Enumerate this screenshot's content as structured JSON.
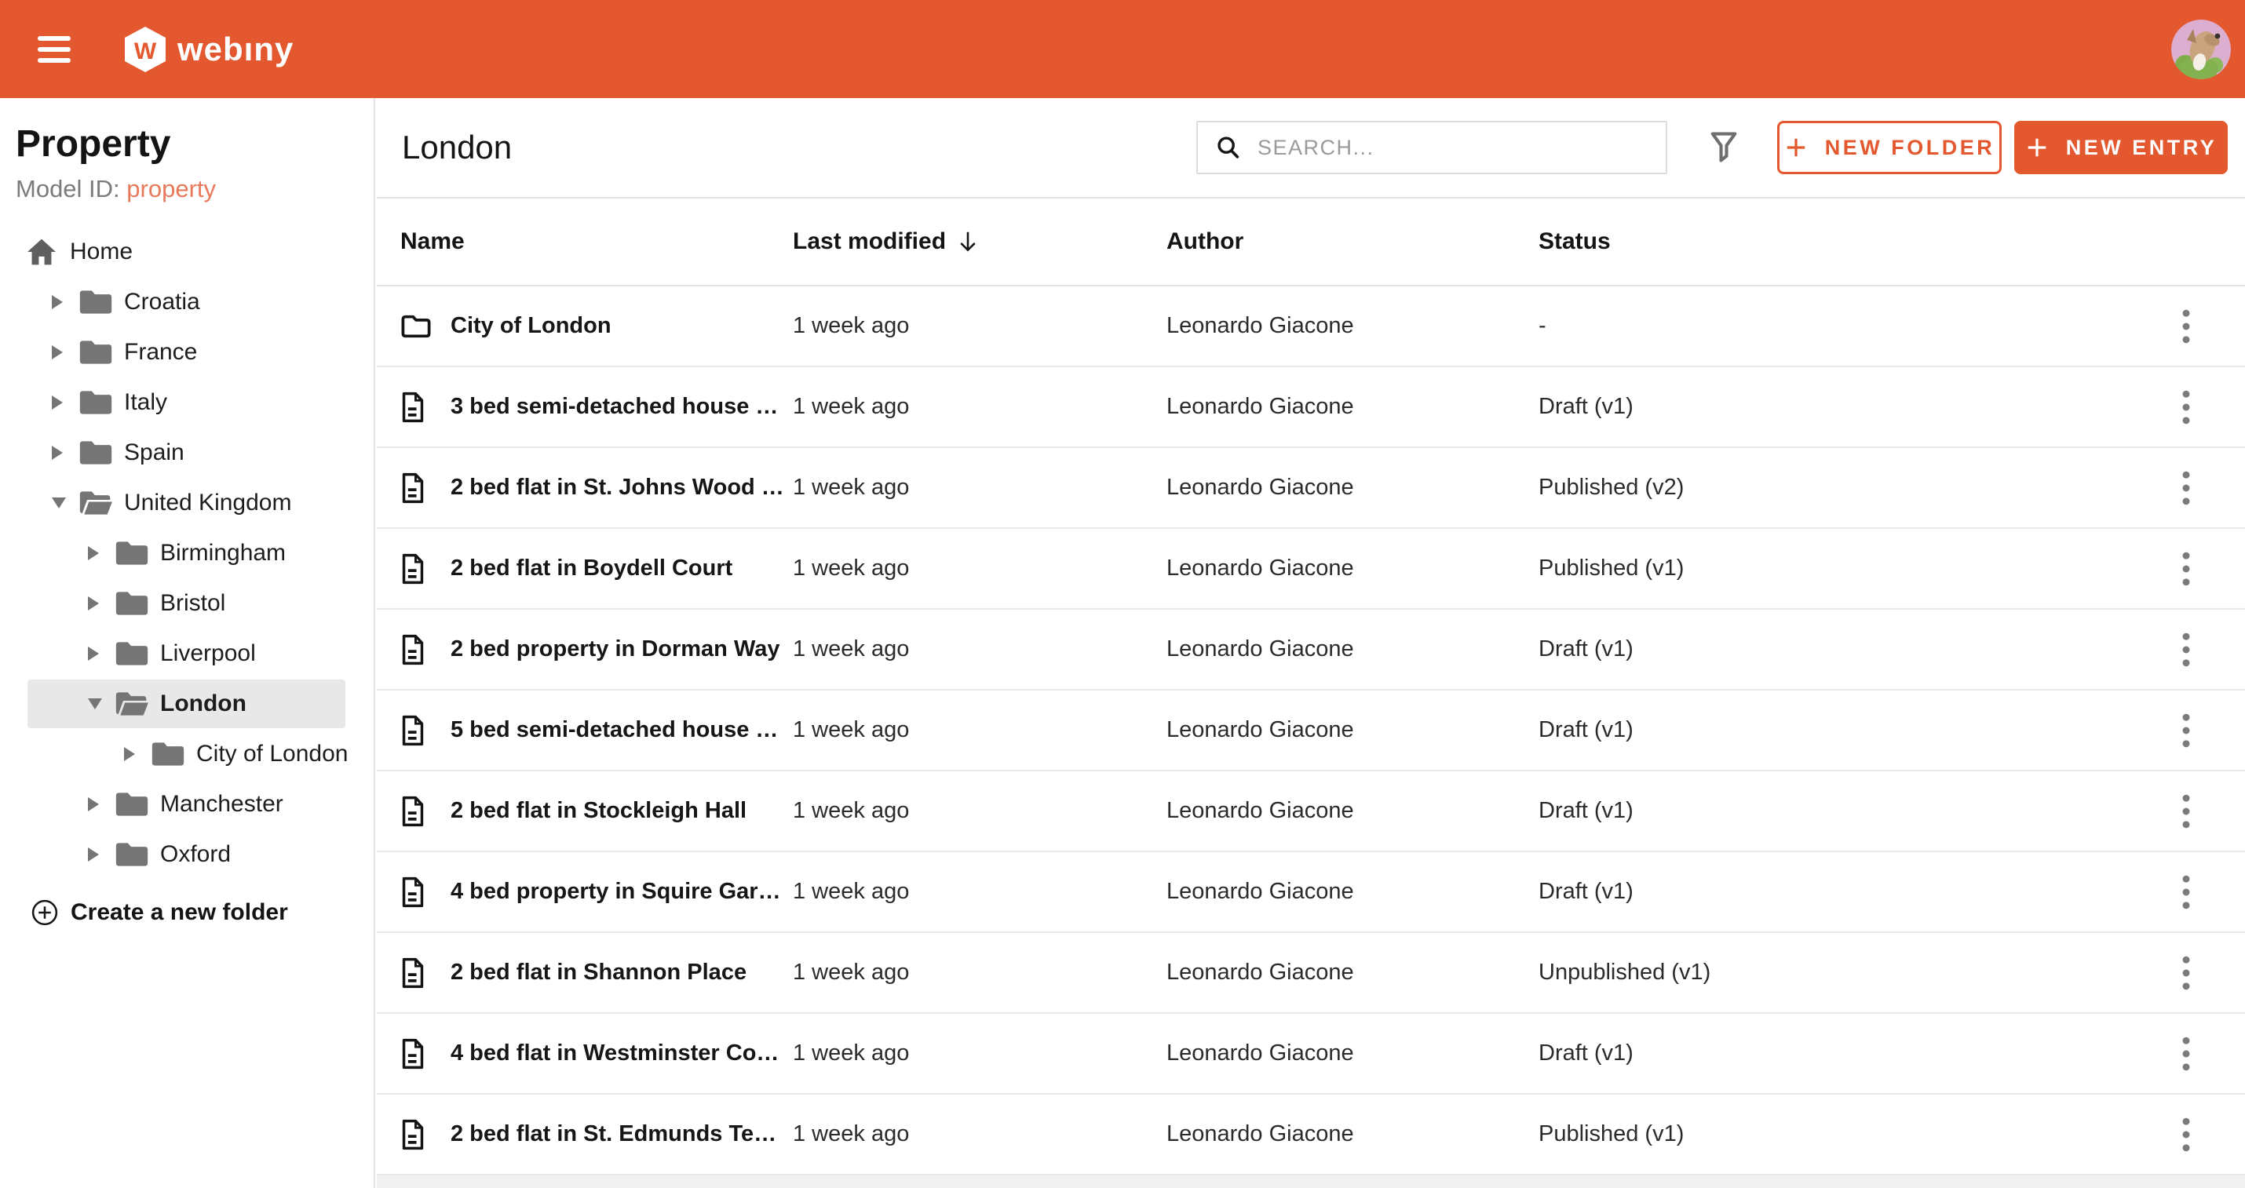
{
  "app_bar": {
    "logo_text": "webıny",
    "logo_letter": "W"
  },
  "sidebar": {
    "title": "Property",
    "model_id_label": "Model ID:",
    "model_id_value": "property",
    "home_label": "Home",
    "create_folder_label": "Create a new folder",
    "tree": [
      {
        "label": "Croatia",
        "level": 1,
        "expanded": false,
        "selected": false
      },
      {
        "label": "France",
        "level": 1,
        "expanded": false,
        "selected": false
      },
      {
        "label": "Italy",
        "level": 1,
        "expanded": false,
        "selected": false
      },
      {
        "label": "Spain",
        "level": 1,
        "expanded": false,
        "selected": false
      },
      {
        "label": "United Kingdom",
        "level": 1,
        "expanded": true,
        "selected": false
      },
      {
        "label": "Birmingham",
        "level": 2,
        "expanded": false,
        "selected": false
      },
      {
        "label": "Bristol",
        "level": 2,
        "expanded": false,
        "selected": false
      },
      {
        "label": "Liverpool",
        "level": 2,
        "expanded": false,
        "selected": false
      },
      {
        "label": "London",
        "level": 2,
        "expanded": true,
        "selected": true
      },
      {
        "label": "City of London",
        "level": 3,
        "expanded": false,
        "selected": false
      },
      {
        "label": "Manchester",
        "level": 2,
        "expanded": false,
        "selected": false
      },
      {
        "label": "Oxford",
        "level": 2,
        "expanded": false,
        "selected": false
      }
    ]
  },
  "content": {
    "title": "London",
    "search_placeholder": "SEARCH...",
    "new_folder_label": "NEW FOLDER",
    "new_entry_label": "NEW ENTRY",
    "table": {
      "columns": {
        "name": "Name",
        "modified": "Last modified",
        "author": "Author",
        "status": "Status"
      },
      "sorted_by": "Last modified",
      "sort_direction": "descending",
      "rows": [
        {
          "type": "folder",
          "name": "City of London",
          "modified": "1 week ago",
          "author": "Leonardo Giacone",
          "status": "-"
        },
        {
          "type": "entry",
          "name": "3 bed semi-detached house …",
          "modified": "1 week ago",
          "author": "Leonardo Giacone",
          "status": "Draft (v1)"
        },
        {
          "type": "entry",
          "name": "2 bed flat in St. Johns Wood …",
          "modified": "1 week ago",
          "author": "Leonardo Giacone",
          "status": "Published (v2)"
        },
        {
          "type": "entry",
          "name": "2 bed flat in Boydell Court",
          "modified": "1 week ago",
          "author": "Leonardo Giacone",
          "status": "Published (v1)"
        },
        {
          "type": "entry",
          "name": "2 bed property in Dorman Way",
          "modified": "1 week ago",
          "author": "Leonardo Giacone",
          "status": "Draft (v1)"
        },
        {
          "type": "entry",
          "name": "5 bed semi-detached house …",
          "modified": "1 week ago",
          "author": "Leonardo Giacone",
          "status": "Draft (v1)"
        },
        {
          "type": "entry",
          "name": "2 bed flat in Stockleigh Hall",
          "modified": "1 week ago",
          "author": "Leonardo Giacone",
          "status": "Draft (v1)"
        },
        {
          "type": "entry",
          "name": "4 bed property in Squire Gar…",
          "modified": "1 week ago",
          "author": "Leonardo Giacone",
          "status": "Draft (v1)"
        },
        {
          "type": "entry",
          "name": "2 bed flat in Shannon Place",
          "modified": "1 week ago",
          "author": "Leonardo Giacone",
          "status": "Unpublished (v1)"
        },
        {
          "type": "entry",
          "name": "4 bed flat in Westminster Co…",
          "modified": "1 week ago",
          "author": "Leonardo Giacone",
          "status": "Draft (v1)"
        },
        {
          "type": "entry",
          "name": "2 bed flat in St. Edmunds Te…",
          "modified": "1 week ago",
          "author": "Leonardo Giacone",
          "status": "Published (v1)"
        }
      ]
    }
  },
  "icons": {
    "menu": "hamburger",
    "logo": "hexagon-w",
    "avatar": "dog-photo",
    "home": "house",
    "tree_collapsed": "caret-right",
    "tree_expanded": "caret-down",
    "folder_closed": "folder",
    "folder_open": "folder-open",
    "create_folder": "plus-circle",
    "search": "magnifier",
    "filter": "funnel",
    "sort": "arrow-down",
    "row_folder": "folder-outline",
    "row_entry": "document",
    "row_menu": "kebab-vertical-dots"
  },
  "colors": {
    "accent": "#e4582f",
    "accent_light": "#e8795a",
    "selected_bg": "#e8e8e8",
    "divider": "#e9e9e9",
    "muted_icon": "#757575",
    "footer_strip": "#f1f1f1"
  }
}
